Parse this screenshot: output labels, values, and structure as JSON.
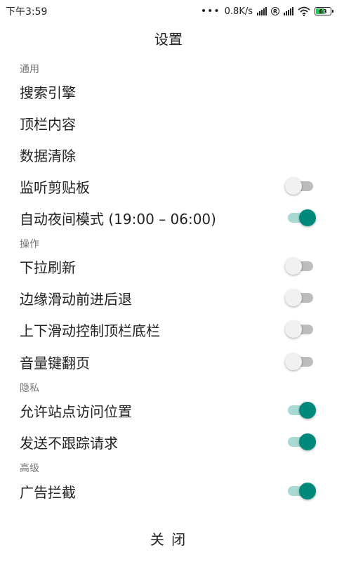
{
  "status_bar": {
    "time": "下午3:59",
    "dots": "•••",
    "speed": "0.8K/s",
    "registered": "R",
    "battery_level": "63",
    "battery_fraction": 0.63,
    "battery_color": "#36c25a"
  },
  "title": "设置",
  "colors": {
    "accent": "#00897b",
    "accent_track": "#a9d9d3",
    "off_track": "#bdbdbd"
  },
  "sections": {
    "general": {
      "header": "通用",
      "items": [
        {
          "label": "搜索引擎"
        },
        {
          "label": "顶栏内容"
        },
        {
          "label": "数据清除"
        },
        {
          "label": "监听剪贴板",
          "toggle": false
        },
        {
          "label": "自动夜间模式 (19:00 – 06:00)",
          "toggle": true
        }
      ]
    },
    "operation": {
      "header": "操作",
      "items": [
        {
          "label": "下拉刷新",
          "toggle": false
        },
        {
          "label": "边缘滑动前进后退",
          "toggle": false
        },
        {
          "label": "上下滑动控制顶栏底栏",
          "toggle": false
        },
        {
          "label": "音量键翻页",
          "toggle": false
        }
      ]
    },
    "privacy": {
      "header": "隐私",
      "items": [
        {
          "label": "允许站点访问位置",
          "toggle": true
        },
        {
          "label": "发送不跟踪请求",
          "toggle": true
        }
      ]
    },
    "advanced": {
      "header": "高级",
      "items": [
        {
          "label": "广告拦截",
          "toggle": true
        }
      ]
    }
  },
  "close_button": "关 闭"
}
